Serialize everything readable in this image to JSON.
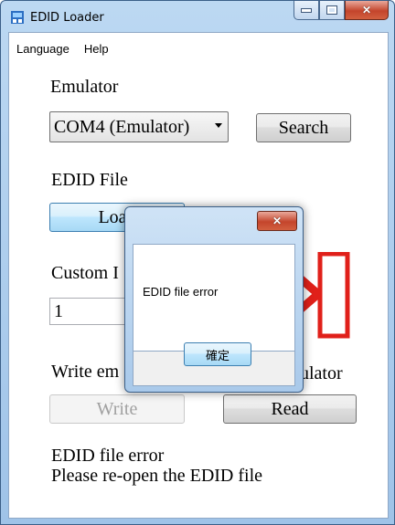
{
  "window": {
    "title": "EDID Loader",
    "minimize_icon": "minimize-icon",
    "maximize_icon": "maximize-icon",
    "close_icon": "close-icon"
  },
  "menu": {
    "items": [
      {
        "label": "Language"
      },
      {
        "label": "Help"
      }
    ]
  },
  "emulator": {
    "label": "Emulator",
    "port_selected": "COM4 (Emulator)",
    "search_button": "Search"
  },
  "edid_file": {
    "label": "EDID File",
    "load_button": "Load"
  },
  "custom": {
    "label": "Custom I",
    "value": "1"
  },
  "write": {
    "label_left": "Write em",
    "label_right": "ulator",
    "write_button": "Write",
    "read_button": "Read"
  },
  "status": {
    "line1": "EDID file error",
    "line2": "Please re-open the EDID file"
  },
  "dialog": {
    "message": "EDID file error",
    "ok_button": "確定"
  },
  "colors": {
    "error_red": "#e0201a"
  }
}
